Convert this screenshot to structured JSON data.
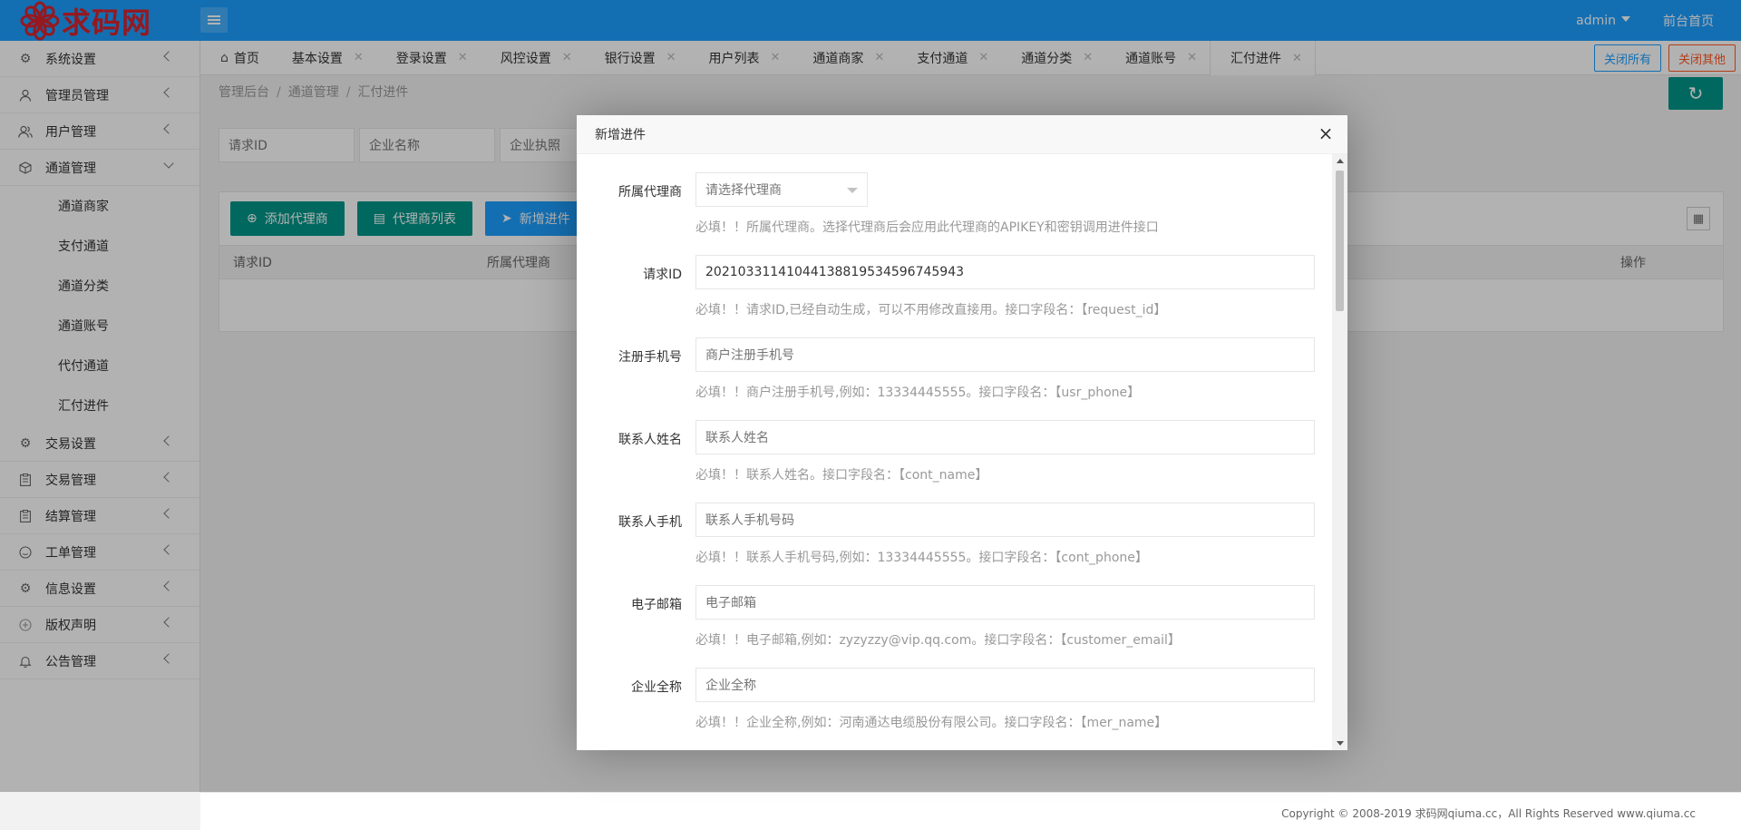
{
  "brand": {
    "name": "求码网",
    "primary": "#1e9fff",
    "accent": "#009688",
    "logo_color": "#d6252f"
  },
  "header": {
    "user": "admin",
    "frontend_link": "前台首页"
  },
  "sidebar": {
    "items": [
      {
        "label": "系统设置",
        "icon": "gear-icon"
      },
      {
        "label": "管理员管理",
        "icon": "user-icon"
      },
      {
        "label": "用户管理",
        "icon": "users-icon"
      },
      {
        "label": "通道管理",
        "icon": "cube-icon",
        "expanded": true,
        "children": [
          "通道商家",
          "支付通道",
          "通道分类",
          "通道账号",
          "代付通道",
          "汇付进件"
        ]
      },
      {
        "label": "交易设置",
        "icon": "gear-icon"
      },
      {
        "label": "交易管理",
        "icon": "clipboard-icon"
      },
      {
        "label": "结算管理",
        "icon": "clipboard-icon"
      },
      {
        "label": "工单管理",
        "icon": "smile-icon"
      },
      {
        "label": "信息设置",
        "icon": "gear-icon"
      },
      {
        "label": "版权声明",
        "icon": "plus-circle-icon"
      },
      {
        "label": "公告管理",
        "icon": "bell-icon"
      }
    ]
  },
  "tabs": {
    "items": [
      "首页",
      "基本设置",
      "登录设置",
      "风控设置",
      "银行设置",
      "用户列表",
      "通道商家",
      "支付通道",
      "通道分类",
      "通道账号",
      "汇付进件"
    ],
    "active": "汇付进件",
    "close_all": "关闭所有",
    "close_other": "关闭其他"
  },
  "breadcrumb": [
    "管理后台",
    "通道管理",
    "汇付进件"
  ],
  "search": {
    "placeholders": [
      "请求ID",
      "企业名称",
      "企业执照"
    ]
  },
  "toolbar": {
    "add_agent": "添加代理商",
    "agent_list": "代理商列表",
    "new_apply": "新增进件"
  },
  "table": {
    "headers": [
      "请求ID",
      "所属代理商",
      "操作"
    ]
  },
  "footer": {
    "copyright": "Copyright © 2008-2019 求码网qiuma.cc，All Rights Reserved www.qiuma.cc"
  },
  "modal": {
    "title": "新增进件",
    "close": "×",
    "fields": [
      {
        "label": "所属代理商",
        "type": "select",
        "placeholder": "请选择代理商",
        "hint": "必填！！所属代理商。选择代理商后会应用此代理商的APIKEY和密钥调用进件接口"
      },
      {
        "label": "请求ID",
        "type": "text",
        "value": "202103311410441388195345967459 43",
        "hint": "必填！！请求ID,已经自动生成，可以不用修改直接用。接口字段名：【request_id】"
      },
      {
        "label": "注册手机号",
        "type": "text",
        "placeholder": "商户注册手机号",
        "hint": "必填！！商户注册手机号,例如：13334445555。接口字段名：【usr_phone】"
      },
      {
        "label": "联系人姓名",
        "type": "text",
        "placeholder": "联系人姓名",
        "hint": "必填！！联系人姓名。接口字段名：【cont_name】"
      },
      {
        "label": "联系人手机",
        "type": "text",
        "placeholder": "联系人手机号码",
        "hint": "必填！！联系人手机号码,例如：13334445555。接口字段名：【cont_phone】"
      },
      {
        "label": "电子邮箱",
        "type": "text",
        "placeholder": "电子邮箱",
        "hint": "必填！！电子邮箱,例如：zyzyzzy@vip.qq.com。接口字段名：【customer_email】"
      },
      {
        "label": "企业全称",
        "type": "text",
        "placeholder": "企业全称",
        "hint": "必填！！企业全称,例如：河南通达电缆股份有限公司。接口字段名：【mer_name】"
      }
    ]
  }
}
